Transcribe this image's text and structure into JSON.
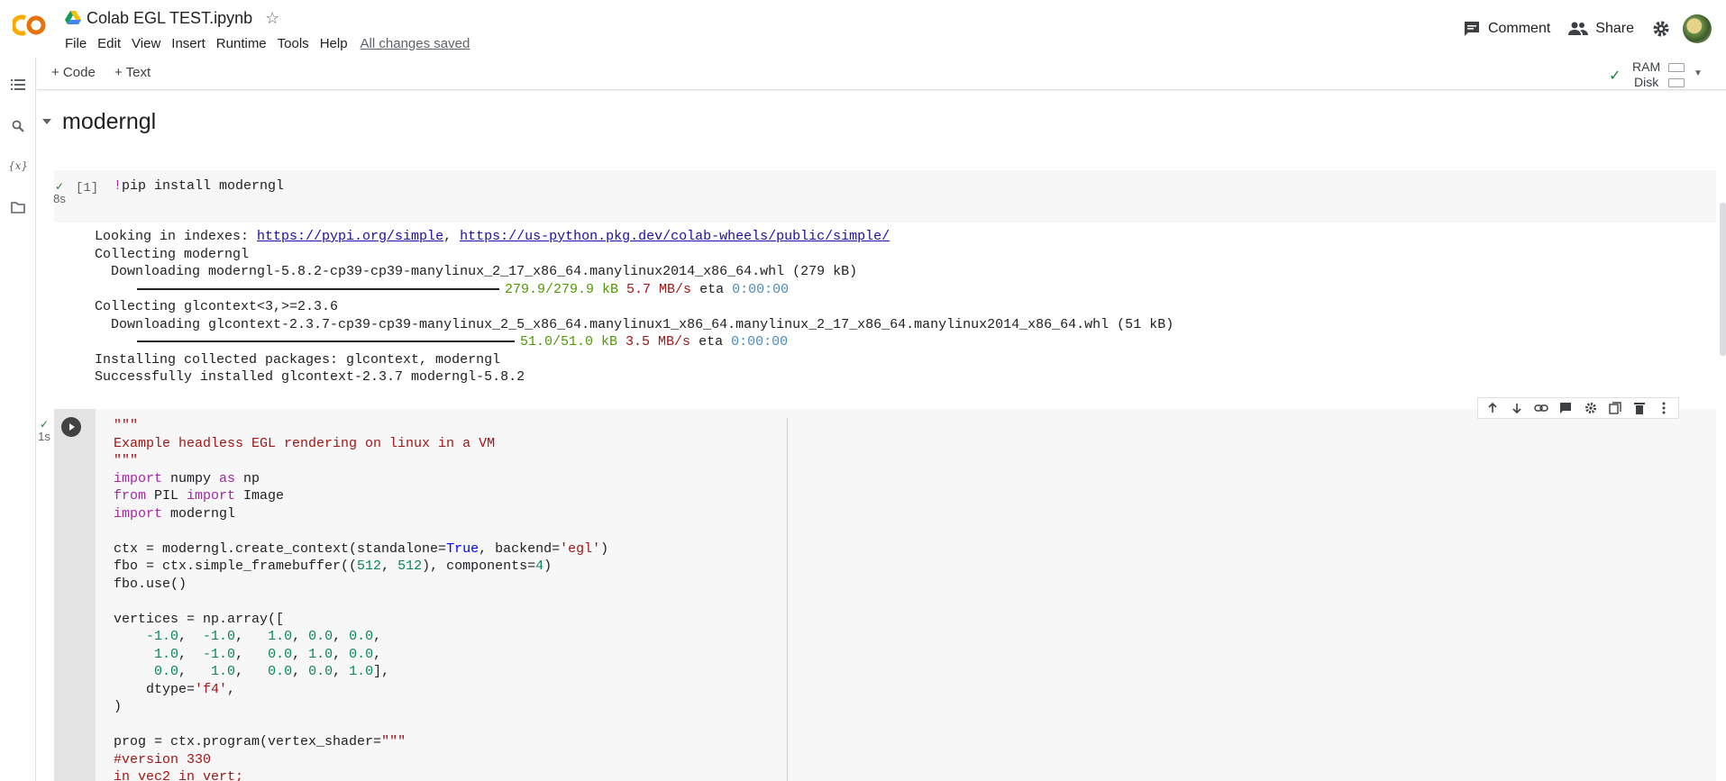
{
  "header": {
    "title": "Colab EGL TEST.ipynb",
    "menu": [
      "File",
      "Edit",
      "View",
      "Insert",
      "Runtime",
      "Tools",
      "Help"
    ],
    "saved_status": "All changes saved",
    "comment_label": "Comment",
    "share_label": "Share"
  },
  "toolbar": {
    "add_code": "+ Code",
    "add_text": "+ Text",
    "ram_label": "RAM",
    "disk_label": "Disk"
  },
  "section": {
    "title": "moderngl"
  },
  "cell1": {
    "index": "[1]",
    "exec_time": "8s",
    "code_bang": "!",
    "code_rest": "pip install moderngl"
  },
  "output1": {
    "l1_prefix": "Looking in indexes: ",
    "l1_link1": "https://pypi.org/simple",
    "l1_sep": ", ",
    "l1_link2": "https://us-python.pkg.dev/colab-wheels/public/simple/",
    "l2": "Collecting moderngl",
    "l3": "  Downloading moderngl-5.8.2-cp39-cp39-manylinux_2_17_x86_64.manylinux2014_x86_64.whl (279 kB)",
    "l4_size": "279.9/279.9 kB",
    "l4_speed": "5.7 MB/s",
    "l4_eta": "eta",
    "l4_time": "0:00:00",
    "l5": "Collecting glcontext<3,>=2.3.6",
    "l6": "  Downloading glcontext-2.3.7-cp39-cp39-manylinux_2_5_x86_64.manylinux1_x86_64.manylinux_2_17_x86_64.manylinux2014_x86_64.whl (51 kB)",
    "l7_size": "51.0/51.0 kB",
    "l7_speed": "3.5 MB/s",
    "l7_eta": "eta",
    "l7_time": "0:00:00",
    "l8": "Installing collected packages: glcontext, moderngl",
    "l9": "Successfully installed glcontext-2.3.7 moderngl-5.8.2"
  },
  "cell2": {
    "exec_time": "1s",
    "c1": "\"\"\"",
    "c2": "Example headless EGL rendering on linux in a VM",
    "c3": "\"\"\"",
    "c4_kw": "import",
    "c4_a": " numpy ",
    "c4_kw2": "as",
    "c4_b": " np",
    "c5_kw": "from",
    "c5_a": " PIL ",
    "c5_kw2": "import",
    "c5_b": " Image",
    "c6_kw": "import",
    "c6_a": " moderngl",
    "c8_a": "ctx = moderngl.create_context(standalone=",
    "c8_true": "True",
    "c8_b": ", backend=",
    "c8_str": "'egl'",
    "c8_c": ")",
    "c9_a": "fbo = ctx.simple_framebuffer((",
    "c9_n1": "512",
    "c9_b": ", ",
    "c9_n2": "512",
    "c9_c": "), components=",
    "c9_n3": "4",
    "c9_d": ")",
    "c10": "fbo.use()",
    "c12": "vertices = np.array([",
    "r1": [
      "-1.0",
      "-1.0",
      "1.0",
      "0.0",
      "0.0"
    ],
    "r2": [
      "1.0",
      "-1.0",
      "0.0",
      "1.0",
      "0.0"
    ],
    "r3": [
      "0.0",
      "1.0",
      "0.0",
      "0.0",
      "1.0"
    ],
    "c16_a": "    dtype=",
    "c16_str": "'f4'",
    "c16_b": ",",
    "c17": ")",
    "c19_a": "prog = ctx.program(vertex_shader=",
    "c19_str": "\"\"\"",
    "c20": "#version 330",
    "c21": "in vec2 in_vert;"
  },
  "colors": {
    "keyword": "#a626a4",
    "string": "#a31515",
    "number": "#098658",
    "boolean": "#0000ff",
    "success": "#188038",
    "logo_orange": "#f9ab00",
    "logo_dark": "#e8710a"
  },
  "icons": [
    "colab-logo",
    "drive-icon",
    "star-icon",
    "comment-icon",
    "share-icon",
    "gear-icon",
    "toc-icon",
    "search-icon",
    "variables-icon",
    "files-icon",
    "run-icon"
  ]
}
